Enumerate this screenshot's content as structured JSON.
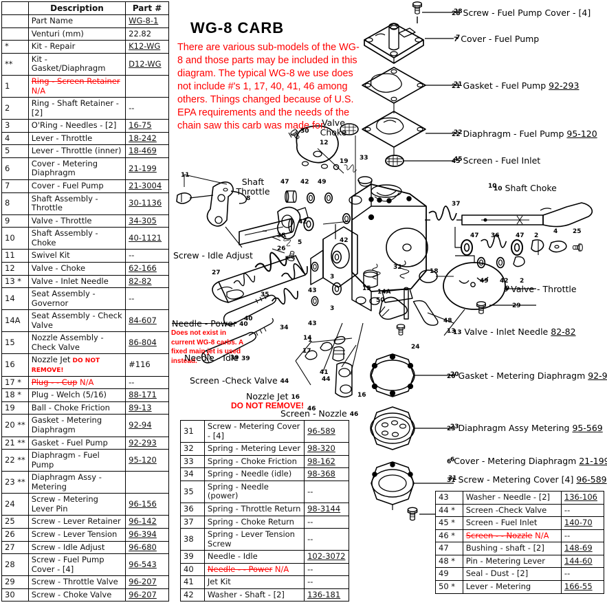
{
  "title": "WG-8   CARB",
  "note": "There are various sub-models of the WG-8 and those parts may be included in this diagram.  The typical WG-8 we use does not include #'s 1, 17, 40, 41, 46 among others.  Things changed because of U.S. EPA requirements and the needs of the chain saw this carb was made for.",
  "colors": {
    "accent_red": "#ff0000",
    "ink": "#000000",
    "paper": "#ffffff"
  },
  "main_table": {
    "headers": [
      "",
      "Description",
      "Part #"
    ],
    "rows": [
      {
        "num": "",
        "desc": "Part Name",
        "pn": "WG-8-1",
        "pn_link": true
      },
      {
        "num": "",
        "desc": "Venturi (mm)",
        "pn": "22.82",
        "pn_link": false
      },
      {
        "num": "*",
        "desc": "Kit - Repair",
        "pn": "K12-WG",
        "pn_link": true
      },
      {
        "num": "**",
        "desc": "Kit - Gasket/Diaphragm",
        "pn": "D12-WG",
        "pn_link": true
      },
      {
        "num": "1",
        "desc": "Ring - Screen Retainer",
        "pn": "",
        "strike": true,
        "na": "N/A"
      },
      {
        "num": "2",
        "desc": "Ring - Shaft Retainer - [2]",
        "pn": "--",
        "pn_link": false
      },
      {
        "num": "3",
        "desc": "O'Ring - Needles - [2]",
        "pn": "16-75",
        "pn_link": true
      },
      {
        "num": "4",
        "desc": "Lever - Throttle",
        "pn": "18-242",
        "pn_link": true
      },
      {
        "num": "5",
        "desc": "Lever - Throttle (inner)",
        "pn": "18-469",
        "pn_link": true
      },
      {
        "num": "6",
        "desc": "Cover - Metering Diaphragm",
        "pn": "21-199",
        "pn_link": true
      },
      {
        "num": "7",
        "desc": "Cover - Fuel Pump",
        "pn": "21-3004",
        "pn_link": true
      },
      {
        "num": "8",
        "desc": "Shaft Assembly - Throttle",
        "pn": "30-1136",
        "pn_link": true
      },
      {
        "num": "9",
        "desc": "Valve - Throttle",
        "pn": "34-305",
        "pn_link": true
      },
      {
        "num": "10",
        "desc": "Shaft Assembly - Choke",
        "pn": "40-1121",
        "pn_link": true
      },
      {
        "num": "11",
        "desc": "Swivel Kit",
        "pn": "--",
        "pn_link": false
      },
      {
        "num": "12",
        "desc": "Valve - Choke",
        "pn": "62-166",
        "pn_link": true
      },
      {
        "num": "13 *",
        "desc": "Valve - Inlet Needle",
        "pn": "82-82",
        "pn_link": true
      },
      {
        "num": "14",
        "desc": "Seat Assembly - Governor",
        "pn": "--",
        "pn_link": false
      },
      {
        "num": "14A",
        "desc": "Seat Assembly - Check Valve",
        "pn": "84-607",
        "pn_link": true
      },
      {
        "num": "15",
        "desc": "Nozzle Assembly - Check Valve",
        "pn": "86-804",
        "pn_link": true
      },
      {
        "num": "16",
        "desc": "Nozzle Jet",
        "pn": "#116",
        "pn_link": false,
        "warn": "DO NOT REMOVE!"
      },
      {
        "num": "17 *",
        "desc": "Plug - - Cup",
        "pn": "--",
        "strike": true,
        "na": "N/A"
      },
      {
        "num": "18 *",
        "desc": "Plug - Welch (5/16)",
        "pn": "88-171",
        "pn_link": true
      },
      {
        "num": "19",
        "desc": "Ball - Choke Friction",
        "pn": "89-13",
        "pn_link": true
      },
      {
        "num": "20 **",
        "desc": "Gasket - Metering Diaphragm",
        "pn": "92-94",
        "pn_link": true
      },
      {
        "num": "21 **",
        "desc": "Gasket - Fuel Pump",
        "pn": "92-293",
        "pn_link": true
      },
      {
        "num": "22 **",
        "desc": "Diaphragm - Fuel Pump",
        "pn": "95-120",
        "pn_link": true
      },
      {
        "num": "23 **",
        "desc": "Diaphragm Assy - Metering",
        "pn": "",
        "pn_link": false
      },
      {
        "num": "24",
        "desc": "Screw - Metering Lever Pin",
        "pn": "96-156",
        "pn_link": true
      },
      {
        "num": "25",
        "desc": "Screw - Lever Retainer",
        "pn": "96-142",
        "pn_link": true
      },
      {
        "num": "26",
        "desc": "Screw - Lever Tension",
        "pn": "96-394",
        "pn_link": true
      },
      {
        "num": "27",
        "desc": "Screw - Idle Adjust",
        "pn": "96-680",
        "pn_link": true
      },
      {
        "num": "28",
        "desc": "Screw - Fuel Pump Cover - [4]",
        "pn": "96-543",
        "pn_link": true
      },
      {
        "num": "29",
        "desc": "Screw - Throttle Valve",
        "pn": "96-207",
        "pn_link": true
      },
      {
        "num": "30",
        "desc": "Screw - Choke Valve",
        "pn": "96-207",
        "pn_link": true
      }
    ]
  },
  "mid_table": {
    "rows": [
      {
        "num": "31",
        "desc": "Screw - Metering Cover - [4]",
        "pn": "96-589",
        "pn_link": true
      },
      {
        "num": "32",
        "desc": "Spring - Metering Lever",
        "pn": "98-320",
        "pn_link": true
      },
      {
        "num": "33",
        "desc": "Spring - Choke Friction",
        "pn": "98-162",
        "pn_link": true
      },
      {
        "num": "34",
        "desc": "Spring - Needle (idle)",
        "pn": "98-368",
        "pn_link": true
      },
      {
        "num": "35",
        "desc": "Spring - Needle (power)",
        "pn": "--",
        "pn_link": false
      },
      {
        "num": "36",
        "desc": "Spring - Throttle Return",
        "pn": "98-3144",
        "pn_link": true
      },
      {
        "num": "37",
        "desc": "Spring - Choke Return",
        "pn": "--",
        "pn_link": false
      },
      {
        "num": "38",
        "desc": "Spring - Lever Tension Screw",
        "pn": "--",
        "pn_link": false
      },
      {
        "num": "39",
        "desc": "Needle - Idle",
        "pn": "102-3072",
        "pn_link": true
      },
      {
        "num": "40",
        "desc": "Needle - - Power",
        "pn": "--",
        "strike": true,
        "na": "N/A"
      },
      {
        "num": "41",
        "desc": "Jet Kit",
        "pn": "--",
        "pn_link": false
      },
      {
        "num": "42",
        "desc": "Washer - Shaft - [2]",
        "pn": "136-181",
        "pn_link": true
      }
    ]
  },
  "right_table": {
    "rows": [
      {
        "num": "43",
        "desc": "Washer - Needle - [2]",
        "pn": "136-106",
        "pn_link": true
      },
      {
        "num": "44 *",
        "desc": "Screen -Check Valve",
        "pn": "--",
        "pn_link": false
      },
      {
        "num": "45 *",
        "desc": "Screen - Fuel Inlet",
        "pn": "140-70",
        "pn_link": true
      },
      {
        "num": "46 *",
        "desc": "Screen - - Nozzle",
        "pn": "--",
        "strike": true,
        "na": "N/A"
      },
      {
        "num": "47",
        "desc": "Bushing - shaft - [2]",
        "pn": "148-69",
        "pn_link": true
      },
      {
        "num": "48 *",
        "desc": "Pin - Metering Lever",
        "pn": "144-60",
        "pn_link": true
      },
      {
        "num": "49",
        "desc": "Seal - Dust - [2]",
        "pn": "--",
        "pn_link": false
      },
      {
        "num": "50 *",
        "desc": "Lever - Metering",
        "pn": "166-55",
        "pn_link": true
      }
    ]
  },
  "callouts": {
    "screw_fuel_pump_cover": {
      "idx": "28",
      "text": "Screw - Fuel Pump Cover - [4]",
      "pn": ""
    },
    "cover_fuel_pump": {
      "idx": "7",
      "text": "Cover - Fuel Pump",
      "pn": ""
    },
    "gasket_fuel_pump": {
      "idx": "21",
      "text": "Gasket - Fuel Pump",
      "pn": "92-293"
    },
    "diaphragm_fuel_pump": {
      "idx": "22",
      "text": "Diaphragm - Fuel Pump",
      "pn": "95-120"
    },
    "screen_fuel_inlet": {
      "idx": "45",
      "text": "Screen - Fuel Inlet",
      "pn": ""
    },
    "shaft_choke": {
      "idx": "10",
      "text": "Shaft Choke",
      "pn": ""
    },
    "valve_throttle": {
      "idx": "9",
      "text": "Valve - Throttle",
      "pn": ""
    },
    "valve_inlet_needle": {
      "idx": "13",
      "text": "Valve - Inlet Needle",
      "pn": "82-82"
    },
    "gasket_metering": {
      "idx": "20",
      "text": "Gasket - Metering  Diaphragm",
      "pn": "92-94"
    },
    "diaphragm_assy_metering": {
      "idx": "23",
      "text": "Diaphragm Assy  Metering",
      "pn": "95-569"
    },
    "cover_metering": {
      "idx": "6",
      "text": "Cover - Metering Diaphragm",
      "pn": "21-199"
    },
    "screw_metering_cover": {
      "idx": "31",
      "text": "Screw - Metering Cover [4]",
      "pn": "96-589"
    },
    "valve_choke": {
      "idx": "12",
      "text": "Valve\nChoke",
      "pn": ""
    },
    "shaft_throttle": {
      "idx": "8",
      "text": "Shaft\nThrottle",
      "pn": ""
    },
    "screw_idle_adjust": {
      "idx": "27",
      "text": "Screw - Idle Adjust",
      "pn": ""
    },
    "needle_power": {
      "idx": "40",
      "text": "Needle -  Power",
      "pn": "",
      "strike": true
    },
    "needle_power_note": {
      "text": "Does not exist in current WG-8 carbs.  A fixed main jet is used instead."
    },
    "needle_idle": {
      "idx": "39",
      "text": "Needle - Idle",
      "pn": ""
    },
    "screen_check_valve": {
      "idx": "44",
      "text": "Screen -Check Valve",
      "pn": ""
    },
    "nozzle_jet": {
      "idx": "16",
      "text": "Nozzle Jet",
      "pn": "",
      "warn": "DO NOT REMOVE!"
    },
    "screen_nozzle": {
      "idx": "46",
      "text": "Screen - Nozzle",
      "pn": ""
    }
  },
  "drawing_numbers": [
    "1",
    "2",
    "3",
    "4",
    "5",
    "8",
    "10",
    "11",
    "12",
    "14",
    "14A",
    "15",
    "17",
    "18",
    "19",
    "24",
    "25",
    "26",
    "27",
    "29",
    "30",
    "32",
    "33",
    "34",
    "35",
    "36",
    "37",
    "38",
    "39",
    "40",
    "41",
    "42",
    "43",
    "46",
    "47",
    "48",
    "49",
    "50"
  ]
}
